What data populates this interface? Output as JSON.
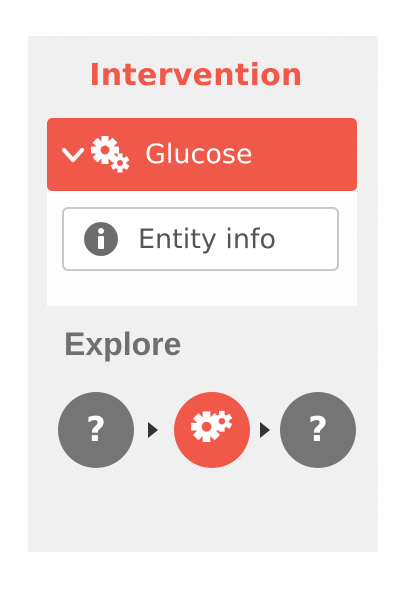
{
  "panel": {
    "title": "Intervention",
    "entity": {
      "name": "Glucose",
      "icon": "gears-icon",
      "expand_icon": "chevron-down-icon"
    },
    "info_button": {
      "label": "Entity info",
      "icon": "info-icon"
    },
    "explore": {
      "heading": "Explore",
      "nodes": [
        {
          "text": "?",
          "icon": "question-icon"
        },
        {
          "text": "",
          "icon": "gears-icon"
        },
        {
          "text": "?",
          "icon": "question-icon"
        }
      ]
    }
  },
  "colors": {
    "accent": "#f0584a",
    "node_gray": "#757575",
    "text_gray": "#6f6f6f"
  }
}
